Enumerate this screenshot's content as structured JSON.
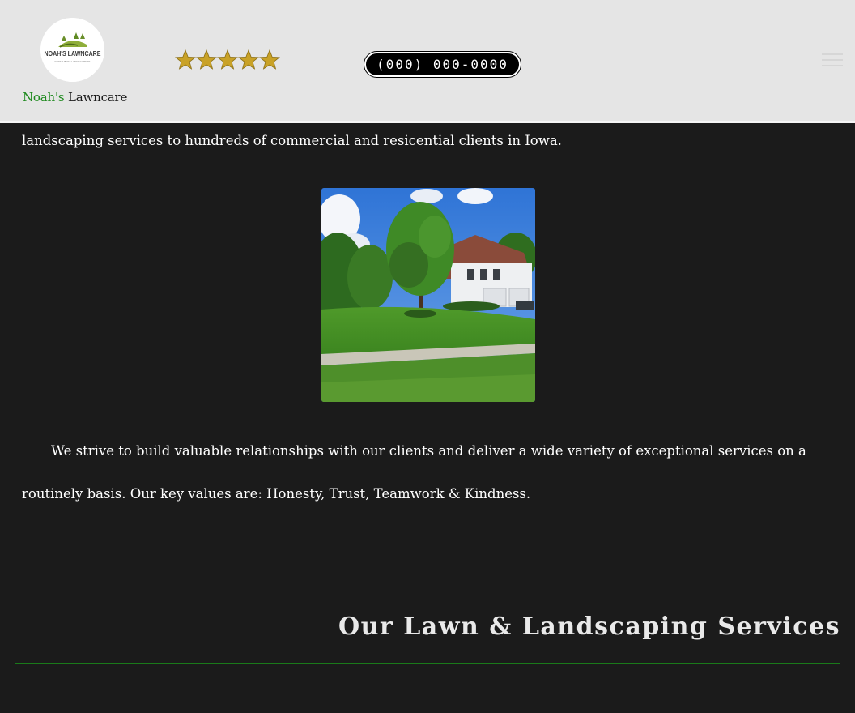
{
  "header": {
    "logo_text": "NOAH'S LAWNCARE",
    "logo_tagline": "IOWA'S BEST LANDSCAPERS",
    "brand_first": "Noah's",
    "brand_second": "Lawncare",
    "rating_stars": 5,
    "phone": "(000) 000-0000",
    "menu_icon": "hamburger-menu-icon"
  },
  "content": {
    "intro_tail": "landscaping services to hundreds of commercial and resicential clients in Iowa.",
    "paragraph": "We strive to build valuable relationships with our clients and deliver a wide variety of exceptional services on a routinely basis. Our key values are: Honesty, Trust, Teamwork & Kindness.",
    "section_title": "Our Lawn & Landscaping Services"
  },
  "colors": {
    "header_bg": "#e5e5e5",
    "page_bg": "#1b1b1b",
    "brand_green": "#1f8a1f",
    "star_gold": "#c9a227",
    "divider_green": "#1a7a1a"
  }
}
